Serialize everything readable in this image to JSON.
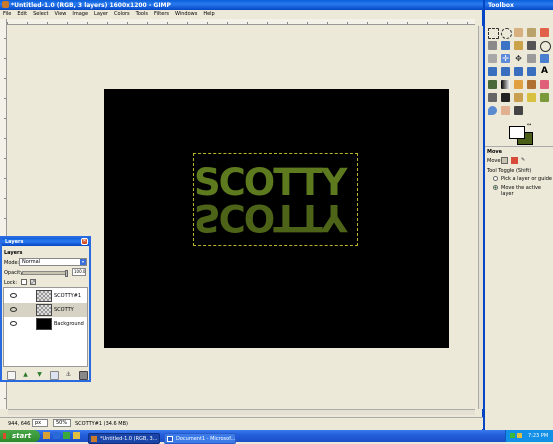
{
  "main_window": {
    "title": "*Untitled-1.0 (RGB, 3 layers) 1600x1200 - GIMP",
    "menu": [
      "File",
      "Edit",
      "Select",
      "View",
      "Image",
      "Layer",
      "Colors",
      "Tools",
      "Filters",
      "Windows",
      "Help"
    ],
    "canvas_text": "SCOTTY",
    "canvas_text_color": "#5e7a1e",
    "status": {
      "coords": "944, 646",
      "unit": "px",
      "zoom": "50%",
      "info": "SCOTTY#1 (34.6 MB)"
    }
  },
  "layers_dialog": {
    "title": "Layers",
    "header": "Layers",
    "mode_label": "Mode:",
    "mode_value": "Normal",
    "opacity_label": "Opacity:",
    "opacity_value": "100.0",
    "lock_label": "Lock:",
    "layers": [
      {
        "name": "SCOTTY#1",
        "thumb": "checker"
      },
      {
        "name": "SCOTTY",
        "thumb": "checker"
      },
      {
        "name": "Background",
        "thumb": "black"
      }
    ]
  },
  "toolbox": {
    "title": "Toolbox",
    "tool_options": {
      "name": "Move",
      "move_label": "Move:",
      "toggle_label": "Tool Toggle (Shift)",
      "options": [
        "Pick a layer or guide",
        "Move the active layer"
      ],
      "selected_index": 1
    },
    "fg_color": "#ffffff",
    "bg_color": "#4a5e18"
  },
  "taskbar": {
    "start_label": "start",
    "items": [
      "*Untitled-1.0 (RGB, 3...",
      "Document1 - Microsof..."
    ],
    "clock": "7:23 PM"
  }
}
